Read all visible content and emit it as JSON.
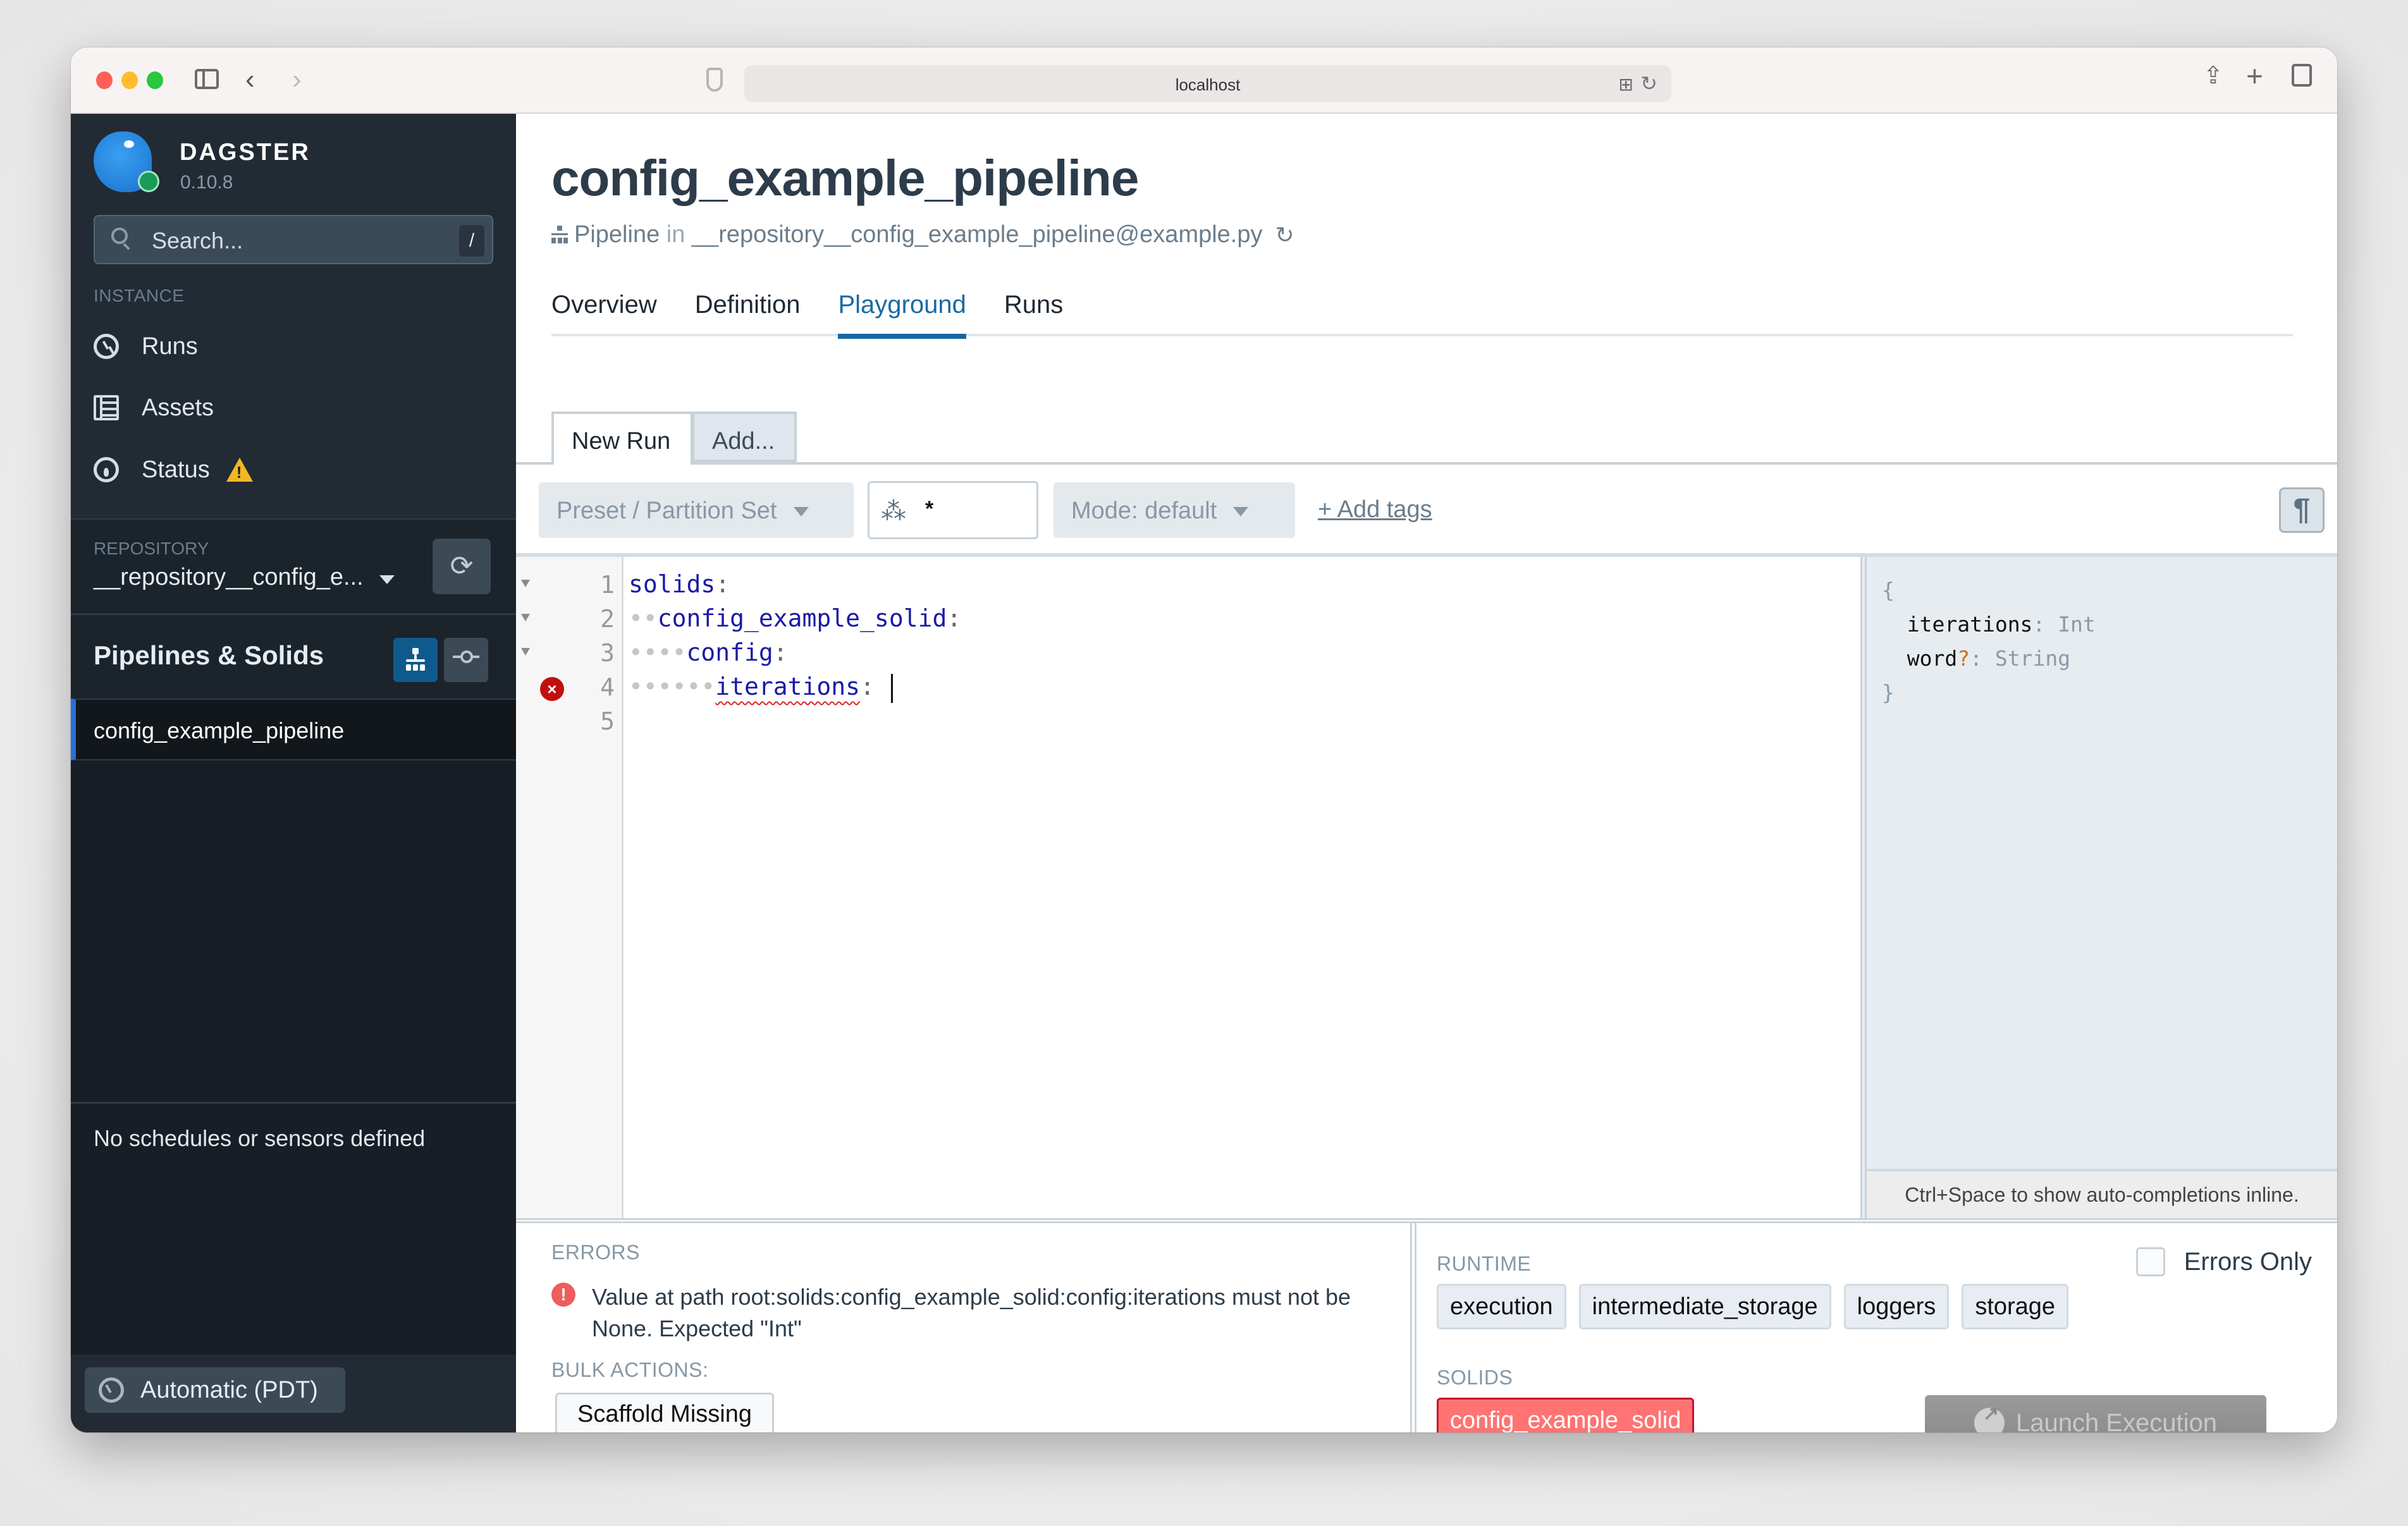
{
  "browser": {
    "url": "localhost",
    "nav_back": "‹",
    "nav_forward": "›",
    "icons": [
      "sidebar-toggle-icon",
      "shield-icon",
      "translate-icon",
      "reload-icon",
      "share-icon",
      "new-tab-icon",
      "tab-overview-icon"
    ]
  },
  "sidebar": {
    "brand": "DAGSTER",
    "version": "0.10.8",
    "search": {
      "placeholder": "Search...",
      "shortcut": "/"
    },
    "instance_label": "INSTANCE",
    "nav_items": [
      {
        "label": "Runs",
        "icon": "history-icon"
      },
      {
        "label": "Assets",
        "icon": "table-icon"
      },
      {
        "label": "Status",
        "icon": "dashboard-icon",
        "warning": true
      }
    ],
    "repository_label": "REPOSITORY",
    "repository_name": "__repository__config_e...",
    "pipelines_title": "Pipelines & Solids",
    "pipelines": [
      {
        "label": "config_example_pipeline",
        "selected": true
      }
    ],
    "schedules_empty": "No schedules or sensors defined",
    "timezone": "Automatic (PDT)"
  },
  "header": {
    "title": "config_example_pipeline",
    "subtitle_kind": "Pipeline",
    "subtitle_in": "in",
    "subtitle_repo": "__repository__config_example_pipeline@example.py",
    "reload_glyph": "↻",
    "tabs": [
      {
        "label": "Overview",
        "active": false
      },
      {
        "label": "Definition",
        "active": false
      },
      {
        "label": "Playground",
        "active": true
      },
      {
        "label": "Runs",
        "active": false
      }
    ]
  },
  "playground": {
    "sessions": [
      {
        "label": "New Run",
        "active": true
      }
    ],
    "add_session": "Add...",
    "preset_select": "Preset / Partition Set",
    "solid_selection": "*",
    "mode_select": "Mode: default",
    "add_tags": "+ Add tags",
    "whitespace_toggle": "¶",
    "editor": {
      "lines": [
        {
          "num": "1",
          "indent": "",
          "key": "solids",
          "fold": true,
          "error": false
        },
        {
          "num": "2",
          "indent": "••",
          "key": "config_example_solid",
          "fold": true,
          "error": false
        },
        {
          "num": "3",
          "indent": "••••",
          "key": "config",
          "fold": true,
          "error": false
        },
        {
          "num": "4",
          "indent": "••••••",
          "key": "iterations",
          "fold": false,
          "error": true
        },
        {
          "num": "5",
          "indent": "",
          "key": "",
          "fold": false,
          "error": false
        }
      ],
      "colon": ":"
    },
    "type_panel": {
      "open_brace": "{",
      "close_brace": "}",
      "fields": [
        {
          "key": "iterations",
          "optional": "",
          "type": "Int"
        },
        {
          "key": "word",
          "optional": "?",
          "type": "String"
        }
      ],
      "hint": "Ctrl+Space to show auto-completions inline."
    }
  },
  "validation": {
    "errors_label": "ERRORS",
    "errors": [
      "Value at path root:solids:config_example_solid:config:iterations must not be None. Expected \"Int\""
    ],
    "bulk_actions_label": "BULK ACTIONS:",
    "scaffold_button": "Scaffold Missing Config",
    "runtime_label": "RUNTIME",
    "runtime_chips": [
      "execution",
      "intermediate_storage",
      "loggers",
      "storage"
    ],
    "errors_only_label": "Errors Only",
    "errors_only_checked": false,
    "solids_label": "SOLIDS",
    "solid_chips": [
      {
        "label": "config_example_solid",
        "error": true
      }
    ],
    "launch_button": "Launch Execution",
    "launch_enabled": false
  },
  "colors": {
    "accent": "#1467a3",
    "sidebar_bg": "#222b34",
    "selected_indicator": "#2b6fd6",
    "error": "#ff7373",
    "warning": "#f2b824",
    "status_ok": "#189b59"
  }
}
